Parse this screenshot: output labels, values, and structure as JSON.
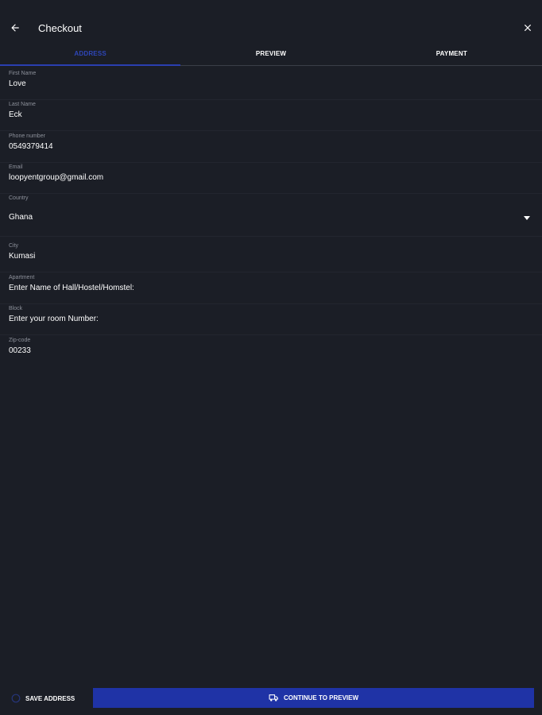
{
  "header": {
    "title": "Checkout",
    "back_icon": "arrow-left-icon",
    "close_icon": "close-icon"
  },
  "tabs": [
    {
      "label": "ADDRESS",
      "active": true
    },
    {
      "label": "PREVIEW",
      "active": false
    },
    {
      "label": "PAYMENT",
      "active": false
    }
  ],
  "form": {
    "first_name": {
      "label": "First Name",
      "value": "Love"
    },
    "last_name": {
      "label": "Last Name",
      "value": "Eck"
    },
    "phone": {
      "label": "Phone number",
      "value": "0549379414"
    },
    "email": {
      "label": "Email",
      "value": "loopyentgroup@gmail.com"
    },
    "country": {
      "label": "Country",
      "value": "Ghana"
    },
    "city": {
      "label": "City",
      "value": "Kumasi"
    },
    "apartment": {
      "label": "Apartment",
      "value": "Enter Name of Hall/Hostel/Homstel:"
    },
    "block": {
      "label": "Block",
      "value": "Enter your room Number:"
    },
    "zip": {
      "label": "Zip-code",
      "value": "00233"
    }
  },
  "footer": {
    "save_label": "SAVE ADDRESS",
    "continue_label": "CONTINUE TO PREVIEW",
    "save_icon": "radio-unchecked-icon",
    "continue_icon": "delivery-truck-icon"
  },
  "colors": {
    "background": "#1b1e26",
    "accent": "#1f33a6",
    "active_tab_text": "#2e46b8",
    "label": "#8d919b",
    "text": "#ffffff"
  }
}
